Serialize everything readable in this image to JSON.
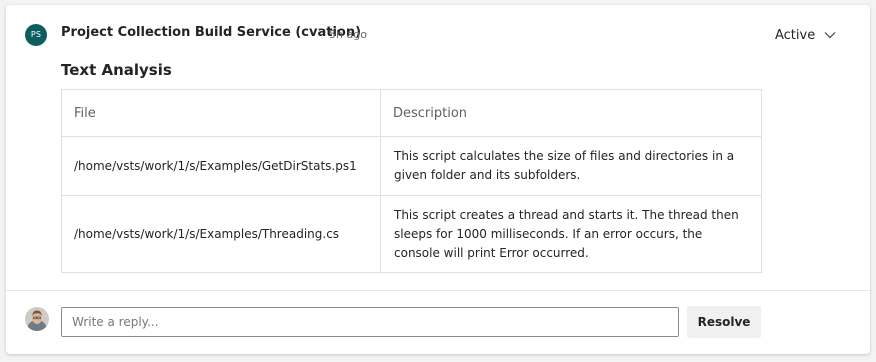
{
  "comment": {
    "author_initials": "PS",
    "author_name": "Project Collection Build Service (cvation)",
    "timestamp": "5h ago",
    "status": "Active",
    "avatar_color": "#0f5c5f"
  },
  "analysis": {
    "heading": "Text Analysis",
    "columns": [
      "File",
      "Description"
    ],
    "rows": [
      {
        "file": "/home/vsts/work/1/s/Examples/GetDirStats.ps1",
        "description": "This script calculates the size of files and directories in a given folder and its subfolders."
      },
      {
        "file": "/home/vsts/work/1/s/Examples/Threading.cs",
        "description": "This script creates a thread and starts it. The thread then sleeps for 1000 milliseconds. If an error occurs, the console will print Error occurred."
      }
    ]
  },
  "reply": {
    "placeholder": "Write a reply...",
    "value": "",
    "resolve_label": "Resolve"
  },
  "icons": {
    "status_dropdown": "chevron-down-icon",
    "user_avatar": "user-avatar"
  }
}
